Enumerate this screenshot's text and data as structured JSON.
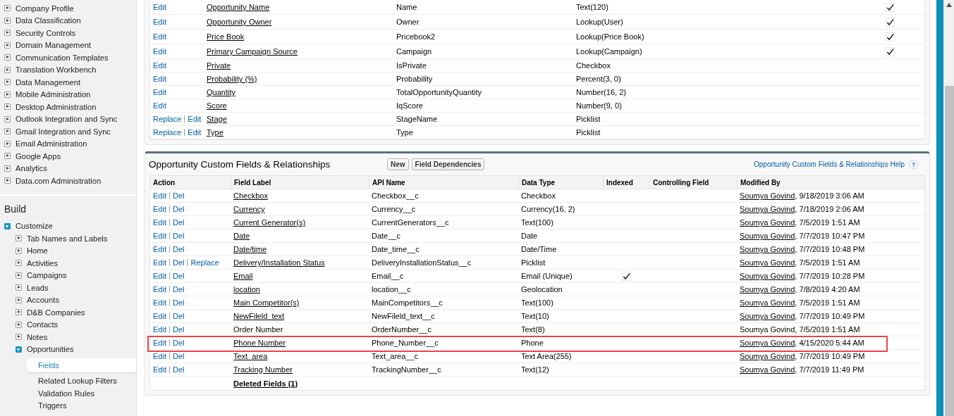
{
  "sidebar": {
    "admin_items": [
      {
        "label": "Company Profile",
        "expanded": false
      },
      {
        "label": "Data Classification",
        "expanded": false
      },
      {
        "label": "Security Controls",
        "expanded": false
      },
      {
        "label": "Domain Management",
        "expanded": false
      },
      {
        "label": "Communication Templates",
        "expanded": false
      },
      {
        "label": "Translation Workbench",
        "expanded": false
      },
      {
        "label": "Data Management",
        "expanded": false
      },
      {
        "label": "Mobile Administration",
        "expanded": false
      },
      {
        "label": "Desktop Administration",
        "expanded": false
      },
      {
        "label": "Outlook Integration and Sync",
        "expanded": false
      },
      {
        "label": "Gmail Integration and Sync",
        "expanded": false
      },
      {
        "label": "Email Administration",
        "expanded": false
      },
      {
        "label": "Google Apps",
        "expanded": false
      },
      {
        "label": "Analytics",
        "expanded": false
      },
      {
        "label": "Data.com Administration",
        "expanded": false
      }
    ],
    "build_title": "Build",
    "build_items": [
      {
        "label": "Customize",
        "expanded": true,
        "children": [
          {
            "label": "Tab Names and Labels",
            "expanded": false
          },
          {
            "label": "Home",
            "expanded": false
          },
          {
            "label": "Activities",
            "expanded": false
          },
          {
            "label": "Campaigns",
            "expanded": false
          },
          {
            "label": "Leads",
            "expanded": false
          },
          {
            "label": "Accounts",
            "expanded": false
          },
          {
            "label": "D&B Companies",
            "expanded": false
          },
          {
            "label": "Contacts",
            "expanded": false
          },
          {
            "label": "Notes",
            "expanded": false
          },
          {
            "label": "Opportunities",
            "expanded": true,
            "children": [
              {
                "label": "Fields",
                "selected": true
              },
              {
                "label": "Related Lookup Filters",
                "selected": false
              },
              {
                "label": "Validation Rules",
                "selected": false
              },
              {
                "label": "Triggers",
                "selected": false
              }
            ]
          }
        ]
      }
    ]
  },
  "standard_fields": {
    "rows": [
      {
        "actions": [
          "Edit"
        ],
        "label": "Opportunity Name",
        "api_name": "Name",
        "data_type": "Text(120)",
        "checked": true
      },
      {
        "actions": [
          "Edit"
        ],
        "label": "Opportunity Owner",
        "api_name": "Owner",
        "data_type": "Lookup(User)",
        "checked": true
      },
      {
        "actions": [
          "Edit"
        ],
        "label": "Price Book",
        "api_name": "Pricebook2",
        "data_type": "Lookup(Price Book)",
        "checked": true
      },
      {
        "actions": [
          "Edit"
        ],
        "label": "Primary Campaign Source",
        "api_name": "Campaign",
        "data_type": "Lookup(Campaign)",
        "checked": true
      },
      {
        "actions": [
          "Edit"
        ],
        "label": "Private",
        "api_name": "IsPrivate",
        "data_type": "Checkbox",
        "checked": false
      },
      {
        "actions": [
          "Edit"
        ],
        "label": "Probability (%)",
        "api_name": "Probability",
        "data_type": "Percent(3, 0)",
        "checked": false
      },
      {
        "actions": [
          "Edit"
        ],
        "label": "Quantity",
        "api_name": "TotalOpportunityQuantity",
        "data_type": "Number(16, 2)",
        "checked": false
      },
      {
        "actions": [
          "Edit"
        ],
        "label": "Score",
        "api_name": "IqScore",
        "data_type": "Number(9, 0)",
        "checked": false
      },
      {
        "actions": [
          "Replace",
          "Edit"
        ],
        "label": "Stage",
        "api_name": "StageName",
        "data_type": "Picklist",
        "checked": false
      },
      {
        "actions": [
          "Replace",
          "Edit"
        ],
        "label": "Type",
        "api_name": "Type",
        "data_type": "Picklist",
        "checked": false
      }
    ]
  },
  "custom_fields": {
    "title": "Opportunity Custom Fields & Relationships",
    "buttons": [
      "New",
      "Field Dependencies"
    ],
    "help_link": "Opportunity Custom Fields & Relationships Help",
    "help_icon": "?",
    "columns": [
      "Action",
      "Field Label",
      "API Name",
      "Data Type",
      "Indexed",
      "Controlling Field",
      "Modified By"
    ],
    "rows": [
      {
        "actions": [
          "Edit",
          "Del"
        ],
        "label": "Checkbox",
        "label_link": true,
        "api_name": "Checkbox__c",
        "data_type": "Checkbox",
        "indexed": false,
        "modified_by": "Soumya Govind",
        "modified_by_link": true,
        "modified_on": ", 9/18/2019 3:06 AM",
        "highlighted": false
      },
      {
        "actions": [
          "Edit",
          "Del"
        ],
        "label": "Currency",
        "label_link": true,
        "api_name": "Currency__c",
        "data_type": "Currency(16, 2)",
        "indexed": false,
        "modified_by": "Soumya Govind",
        "modified_by_link": true,
        "modified_on": ", 7/18/2019 2:06 AM",
        "highlighted": false
      },
      {
        "actions": [
          "Edit",
          "Del"
        ],
        "label": "Current Generator(s)",
        "label_link": true,
        "api_name": "CurrentGenerators__c",
        "data_type": "Text(100)",
        "indexed": false,
        "modified_by": "Soumya Govind",
        "modified_by_link": true,
        "modified_on": ", 7/5/2019 1:51 AM",
        "highlighted": false
      },
      {
        "actions": [
          "Edit",
          "Del"
        ],
        "label": "Date",
        "label_link": true,
        "api_name": "Date__c",
        "data_type": "Date",
        "indexed": false,
        "modified_by": "Soumya Govind",
        "modified_by_link": true,
        "modified_on": ", 7/7/2019 10:47 PM",
        "highlighted": false
      },
      {
        "actions": [
          "Edit",
          "Del"
        ],
        "label": "Date/time",
        "label_link": true,
        "api_name": "Date_time__c",
        "data_type": "Date/Time",
        "indexed": false,
        "modified_by": "Soumya Govind",
        "modified_by_link": true,
        "modified_on": ", 7/7/2019 10:48 PM",
        "highlighted": false
      },
      {
        "actions": [
          "Edit",
          "Del",
          "Replace"
        ],
        "label": "Delivery/Installation Status",
        "label_link": true,
        "api_name": "DeliveryInstallationStatus__c",
        "data_type": "Picklist",
        "indexed": false,
        "modified_by": "Soumya Govind",
        "modified_by_link": true,
        "modified_on": ", 7/5/2019 1:51 AM",
        "highlighted": false
      },
      {
        "actions": [
          "Edit",
          "Del"
        ],
        "label": "Email",
        "label_link": true,
        "api_name": "Email__c",
        "data_type": "Email (Unique)",
        "indexed": true,
        "modified_by": "Soumya Govind",
        "modified_by_link": true,
        "modified_on": ", 7/7/2019 10:28 PM",
        "highlighted": false
      },
      {
        "actions": [
          "Edit",
          "Del"
        ],
        "label": "location",
        "label_link": true,
        "api_name": "location__c",
        "data_type": "Geolocation",
        "indexed": false,
        "modified_by": "Soumya Govind",
        "modified_by_link": true,
        "modified_on": ", 7/8/2019 4:20 AM",
        "highlighted": false
      },
      {
        "actions": [
          "Edit",
          "Del"
        ],
        "label": "Main Competitor(s)",
        "label_link": true,
        "api_name": "MainCompetitors__c",
        "data_type": "Text(100)",
        "indexed": false,
        "modified_by": "Soumya Govind",
        "modified_by_link": true,
        "modified_on": ", 7/5/2019 1:51 AM",
        "highlighted": false
      },
      {
        "actions": [
          "Edit",
          "Del"
        ],
        "label": "NewFileld_text",
        "label_link": true,
        "api_name": "NewFileld_text__c",
        "data_type": "Text(10)",
        "indexed": false,
        "modified_by": "Soumya Govind",
        "modified_by_link": true,
        "modified_on": ", 7/7/2019 10:49 PM",
        "highlighted": false
      },
      {
        "actions": [
          "Edit",
          "Del"
        ],
        "label": "Order Number",
        "label_link": false,
        "api_name": "OrderNumber__c",
        "data_type": "Text(8)",
        "indexed": false,
        "modified_by": "Soumya Govind",
        "modified_by_link": false,
        "modified_on": ", 7/5/2019 1:51 AM",
        "highlighted": false
      },
      {
        "actions": [
          "Edit",
          "Del"
        ],
        "label": "Phone Number",
        "label_link": true,
        "api_name": "Phone_Number__c",
        "data_type": "Phone",
        "indexed": false,
        "modified_by": "Soumya Govind",
        "modified_by_link": true,
        "modified_on": ", 4/15/2020 5:44 AM",
        "highlighted": true
      },
      {
        "actions": [
          "Edit",
          "Del"
        ],
        "label": "Text_area",
        "label_link": true,
        "api_name": "Text_area__c",
        "data_type": "Text Area(255)",
        "indexed": false,
        "modified_by": "Soumya Govind",
        "modified_by_link": true,
        "modified_on": ", 7/7/2019 10:49 PM",
        "highlighted": false
      },
      {
        "actions": [
          "Edit",
          "Del"
        ],
        "label": "Tracking Number",
        "label_link": true,
        "api_name": "TrackingNumber__c",
        "data_type": "Text(12)",
        "indexed": false,
        "modified_by": "Soumya Govind",
        "modified_by_link": true,
        "modified_on": ", 7/7/2019 11:49 PM",
        "highlighted": false
      }
    ],
    "deleted_fields_link": "Deleted Fields (1)"
  }
}
